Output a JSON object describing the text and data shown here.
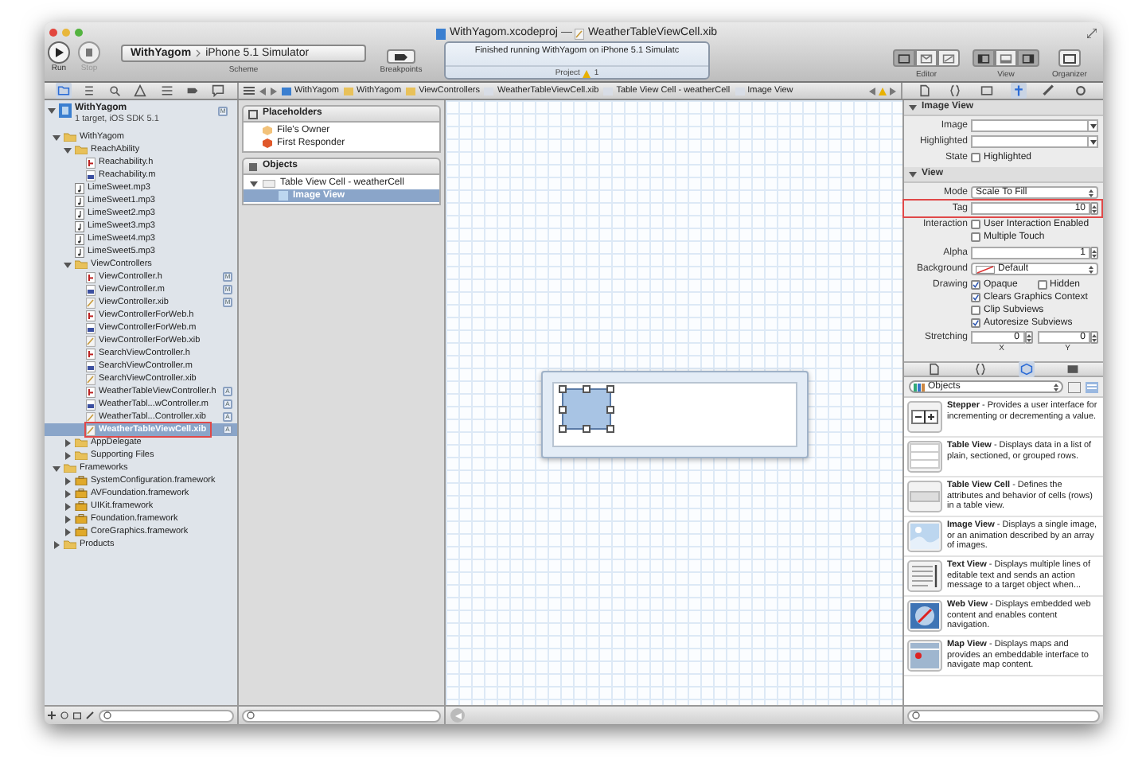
{
  "window": {
    "title": "WithYagom.xcodeproj",
    "separator": "—",
    "document": "WeatherTableViewCell.xib"
  },
  "toolbar": {
    "run": "Run",
    "stop": "Stop",
    "scheme": [
      "WithYagom",
      "iPhone 5.1 Simulator"
    ],
    "scheme_label": "Scheme",
    "breakpoints": "Breakpoints",
    "activity": {
      "message": "Finished running WithYagom on iPhone 5.1 Simulatc",
      "detail": "Project",
      "warnings": "1"
    },
    "editor": {
      "label": "Editor",
      "segments": [
        {
          "kind": "standard",
          "selected": true
        },
        {
          "kind": "assistant",
          "selected": false
        },
        {
          "kind": "version",
          "selected": false
        }
      ]
    },
    "view": {
      "label": "View",
      "segments": [
        {
          "kind": "left",
          "selected": true
        },
        {
          "kind": "bottom",
          "selected": false
        },
        {
          "kind": "right",
          "selected": true
        }
      ]
    },
    "organizer": "Organizer"
  },
  "navigator_tabs": [
    {
      "kind": "project",
      "selected": true
    },
    {
      "kind": "symbol",
      "selected": false
    },
    {
      "kind": "search",
      "selected": false
    },
    {
      "kind": "issue",
      "selected": false
    },
    {
      "kind": "debug",
      "selected": false
    },
    {
      "kind": "breakpoint",
      "selected": false
    },
    {
      "kind": "log",
      "selected": false
    }
  ],
  "jump_bar": [
    "WithYagom",
    "WithYagom",
    "ViewControllers",
    "WeatherTableViewCell.xib",
    "Table View Cell - weatherCell",
    "Image View"
  ],
  "navigator": {
    "project": {
      "name": "WithYagom",
      "subtitle": "1 target, iOS SDK 5.1",
      "badge": "M",
      "expanded": true
    },
    "items": [
      {
        "name": "WithYagom",
        "kind": "folder",
        "expanded": true,
        "selected": false,
        "children": [
          {
            "name": "ReachAbility",
            "kind": "folder",
            "expanded": true,
            "selected": false,
            "children": [
              {
                "name": "Reachability.h",
                "kind": "header",
                "selected": false
              },
              {
                "name": "Reachability.m",
                "kind": "source",
                "selected": false
              }
            ]
          },
          {
            "name": "LimeSweet.mp3",
            "kind": "audio",
            "selected": false
          },
          {
            "name": "LimeSweet1.mp3",
            "kind": "audio",
            "selected": false
          },
          {
            "name": "LimeSweet2.mp3",
            "kind": "audio",
            "selected": false
          },
          {
            "name": "LimeSweet3.mp3",
            "kind": "audio",
            "selected": false
          },
          {
            "name": "LimeSweet4.mp3",
            "kind": "audio",
            "selected": false
          },
          {
            "name": "LimeSweet5.mp3",
            "kind": "audio",
            "selected": false
          },
          {
            "name": "ViewControllers",
            "kind": "folder",
            "expanded": true,
            "selected": false,
            "children": [
              {
                "name": "ViewController.h",
                "kind": "header",
                "badge": "M",
                "selected": false
              },
              {
                "name": "ViewController.m",
                "kind": "source",
                "badge": "M",
                "selected": false
              },
              {
                "name": "ViewController.xib",
                "kind": "xib",
                "badge": "M",
                "selected": false
              },
              {
                "name": "ViewControllerForWeb.h",
                "kind": "header",
                "selected": false
              },
              {
                "name": "ViewControllerForWeb.m",
                "kind": "source",
                "selected": false
              },
              {
                "name": "ViewControllerForWeb.xib",
                "kind": "xib",
                "selected": false
              },
              {
                "name": "SearchViewController.h",
                "kind": "header",
                "selected": false
              },
              {
                "name": "SearchViewController.m",
                "kind": "source",
                "selected": false
              },
              {
                "name": "SearchViewController.xib",
                "kind": "xib",
                "selected": false
              },
              {
                "name": "WeatherTableViewController.h",
                "kind": "header",
                "badge": "A",
                "selected": false
              },
              {
                "name": "WeatherTabl...wController.m",
                "kind": "source",
                "badge": "A",
                "selected": false
              },
              {
                "name": "WeatherTabl...Controller.xib",
                "kind": "xib",
                "badge": "A",
                "selected": false
              },
              {
                "name": "WeatherTableViewCell.xib",
                "kind": "xib",
                "badge": "A",
                "selected": true,
                "annotated": true
              }
            ]
          },
          {
            "name": "AppDelegate",
            "kind": "folder",
            "expanded": false,
            "selected": false
          },
          {
            "name": "Supporting Files",
            "kind": "folder",
            "expanded": false,
            "selected": false
          }
        ]
      },
      {
        "name": "Frameworks",
        "kind": "folder",
        "expanded": true,
        "selected": false,
        "children": [
          {
            "name": "SystemConfiguration.framework",
            "kind": "framework",
            "expanded": false,
            "selected": false
          },
          {
            "name": "AVFoundation.framework",
            "kind": "framework",
            "expanded": false,
            "selected": false
          },
          {
            "name": "UIKit.framework",
            "kind": "framework",
            "expanded": false,
            "selected": false
          },
          {
            "name": "Foundation.framework",
            "kind": "framework",
            "expanded": false,
            "selected": false
          },
          {
            "name": "CoreGraphics.framework",
            "kind": "framework",
            "expanded": false,
            "selected": false
          }
        ]
      },
      {
        "name": "Products",
        "kind": "folder",
        "expanded": false,
        "selected": false
      }
    ]
  },
  "outline": {
    "groups": [
      {
        "title": "Placeholders",
        "kind": "placeholders",
        "items": [
          {
            "name": "File's Owner",
            "kind": "owner",
            "selected": false
          },
          {
            "name": "First Responder",
            "kind": "responder",
            "selected": false
          }
        ]
      },
      {
        "title": "Objects",
        "kind": "objects",
        "items": [
          {
            "name": "Table View Cell - weatherCell",
            "kind": "cell",
            "selected": false,
            "expanded": true,
            "children": [
              {
                "name": "Image View",
                "kind": "image",
                "selected": true
              }
            ]
          }
        ]
      }
    ]
  },
  "inspector_tabs": [
    {
      "kind": "file",
      "selected": false
    },
    {
      "kind": "help",
      "selected": false
    },
    {
      "kind": "identity",
      "selected": false
    },
    {
      "kind": "attributes",
      "selected": true
    },
    {
      "kind": "size",
      "selected": false
    },
    {
      "kind": "connections",
      "selected": false
    }
  ],
  "inspector": {
    "sections": [
      {
        "title": "Image View",
        "expanded": true,
        "rows": [
          {
            "kind": "combo",
            "label": "Image"
          },
          {
            "kind": "combo",
            "label": "Highlighted"
          },
          {
            "kind": "checks",
            "label": "State",
            "checks": [
              {
                "label": "Highlighted",
                "checked": false,
                "kind": "full"
              }
            ]
          }
        ]
      },
      {
        "title": "View",
        "expanded": true,
        "rows": [
          {
            "kind": "popup",
            "label": "Mode",
            "value": "Scale To Fill"
          },
          {
            "kind": "stepper",
            "label": "Tag",
            "value": "10",
            "annotated": true
          },
          {
            "kind": "checks",
            "label": "Interaction",
            "checks": [
              {
                "label": "User Interaction Enabled",
                "checked": false,
                "kind": "full"
              },
              {
                "label": "Multiple Touch",
                "checked": false,
                "kind": "full"
              }
            ]
          },
          {
            "kind": "stepper",
            "label": "Alpha",
            "value": "1",
            "annotated": false
          },
          {
            "kind": "color",
            "label": "Background",
            "value": "Default"
          },
          {
            "kind": "checks",
            "label": "Drawing",
            "checks": [
              {
                "label": "Opaque",
                "checked": true,
                "kind": "half"
              },
              {
                "label": "Hidden",
                "checked": false,
                "kind": "half"
              },
              {
                "label": "Clears Graphics Context",
                "checked": true,
                "kind": "full"
              },
              {
                "label": "Clip Subviews",
                "checked": false,
                "kind": "full"
              },
              {
                "label": "Autoresize Subviews",
                "checked": true,
                "kind": "full"
              }
            ]
          },
          {
            "kind": "pair",
            "label": "Stretching",
            "values": [
              {
                "value": "0",
                "axis": "X"
              },
              {
                "value": "0",
                "axis": "Y"
              }
            ]
          }
        ]
      }
    ]
  },
  "library_tabs": [
    {
      "kind": "file",
      "selected": false
    },
    {
      "kind": "snippet",
      "selected": false
    },
    {
      "kind": "object",
      "selected": true
    },
    {
      "kind": "media",
      "selected": false
    }
  ],
  "library": {
    "filter": "Objects",
    "items": [
      {
        "kind": "stepper",
        "text": "**Stepper** - Provides a user interface for incrementing or decrementing a value."
      },
      {
        "kind": "table",
        "text": "**Table View** - Displays data in a list of plain, sectioned, or grouped rows."
      },
      {
        "kind": "cell",
        "text": "**Table View Cell** - Defines the attributes and behavior of cells (rows) in a table view."
      },
      {
        "kind": "image",
        "text": "**Image View** - Displays a single image, or an animation described by an array of images."
      },
      {
        "kind": "text",
        "text": "**Text View** - Displays multiple lines of editable text and sends an action message to a target object when..."
      },
      {
        "kind": "web",
        "text": "**Web View** - Displays embedded web content and enables content navigation."
      },
      {
        "kind": "map",
        "text": "**Map View** - Displays maps and provides an embeddable interface to navigate map content."
      }
    ]
  }
}
